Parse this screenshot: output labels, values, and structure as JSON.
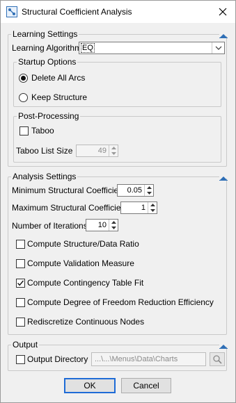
{
  "window": {
    "title": "Structural Coefficient Analysis"
  },
  "learning": {
    "legend": "Learning Settings",
    "algorithm_label": "Learning Algorithm",
    "algorithm_value": "EQ",
    "startup": {
      "legend": "Startup Options",
      "options": [
        "Delete All Arcs",
        "Keep Structure"
      ],
      "selected": "Delete All Arcs"
    },
    "post": {
      "legend": "Post-Processing",
      "taboo_label": "Taboo",
      "taboo_checked": false,
      "taboo_size_label": "Taboo List Size",
      "taboo_size_value": "49"
    }
  },
  "analysis": {
    "legend": "Analysis Settings",
    "min_label": "Minimum Structural Coefficient",
    "min_value": "0.05",
    "max_label": "Maximum Structural Coefficient",
    "max_value": "1",
    "iter_label": "Number of Iterations",
    "iter_value": "10",
    "checks": [
      {
        "label": "Compute Structure/Data Ratio",
        "checked": false
      },
      {
        "label": "Compute Validation Measure",
        "checked": false
      },
      {
        "label": "Compute Contingency Table Fit",
        "checked": true
      },
      {
        "label": "Compute Degree of Freedom Reduction Efficiency",
        "checked": false
      },
      {
        "label": "Rediscretize Continuous Nodes",
        "checked": false
      }
    ]
  },
  "output": {
    "legend": "Output",
    "dir_label": "Output Directory",
    "dir_checked": false,
    "dir_value": "...\\...\\Menus\\Data\\Charts"
  },
  "buttons": {
    "ok": "OK",
    "cancel": "Cancel"
  },
  "icons": {
    "app": "network-graph-icon",
    "close": "close-icon",
    "collapse": "collapse-triangle-icon",
    "dropdown": "chevron-down-icon",
    "spin_up": "spin-up-icon",
    "spin_down": "spin-down-icon",
    "browse": "magnifier-icon"
  },
  "colors": {
    "accent": "#1e6bd6",
    "background": "#f0f0f0",
    "titlebar": "#ffffff"
  }
}
